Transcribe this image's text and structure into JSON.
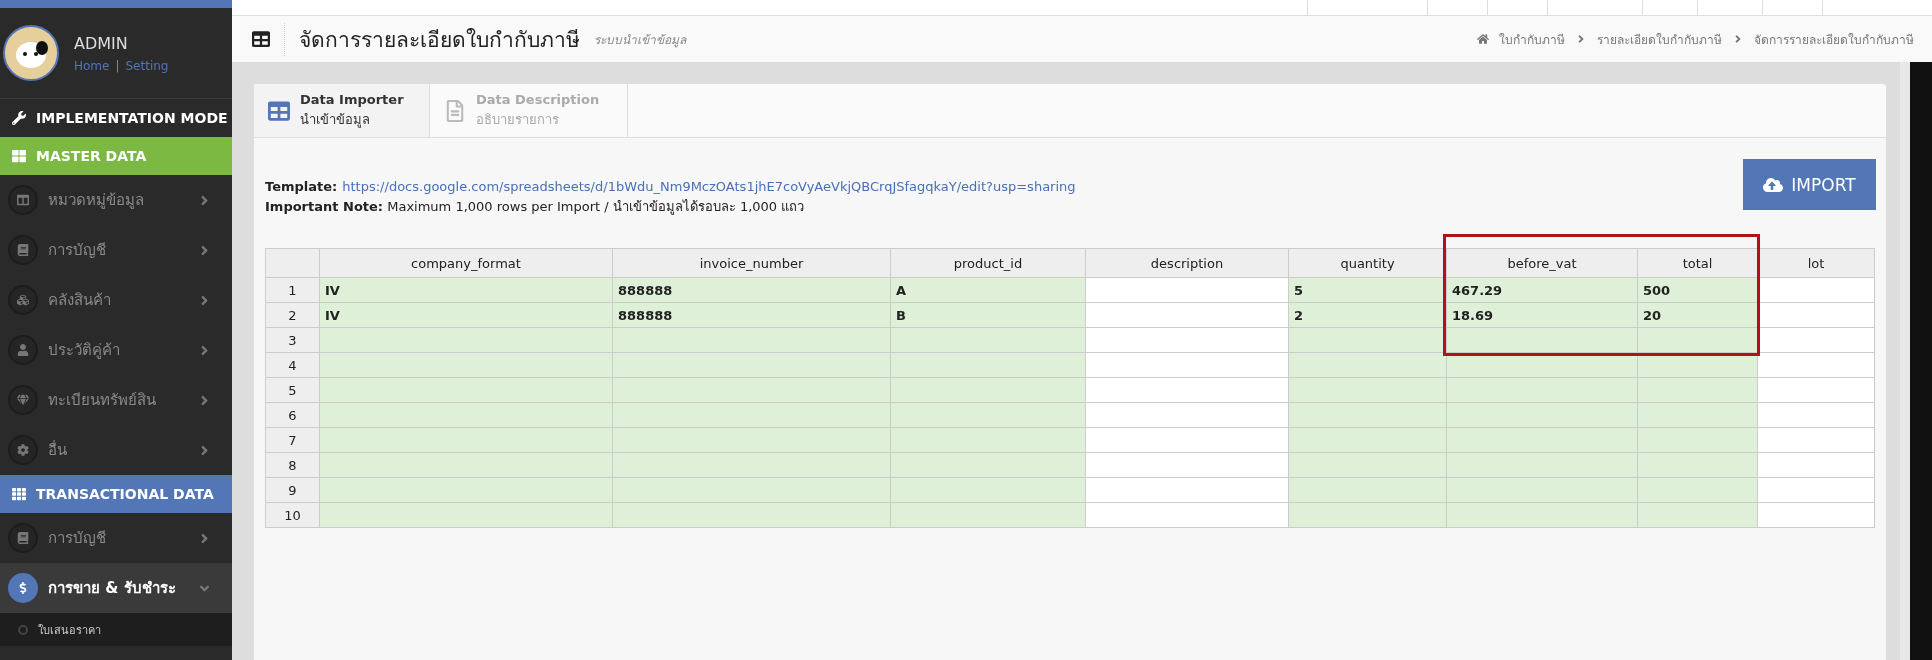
{
  "profile": {
    "name": "ADMIN",
    "links": [
      {
        "label": "Home"
      },
      {
        "label": "Setting"
      }
    ],
    "separator": "|"
  },
  "sidebar": [
    {
      "kind": "mode",
      "label": "IMPLEMENTATION MODE"
    },
    {
      "kind": "section",
      "label": "MASTER DATA",
      "color": "#7cb943"
    },
    {
      "kind": "item",
      "label": "หมวดหมู่ข้อมูล",
      "selected": false,
      "expanded": false
    },
    {
      "kind": "item",
      "label": "การบัญชี",
      "selected": false,
      "expanded": false
    },
    {
      "kind": "item",
      "label": "คลังสินค้า",
      "selected": false,
      "expanded": false
    },
    {
      "kind": "item",
      "label": "ประวัติคู่ค้า",
      "selected": false,
      "expanded": false
    },
    {
      "kind": "item",
      "label": "ทะเบียนทรัพย์สิน",
      "selected": false,
      "expanded": false
    },
    {
      "kind": "item",
      "label": "อื่น",
      "selected": false,
      "expanded": false
    },
    {
      "kind": "section",
      "label": "TRANSACTIONAL DATA",
      "color": "#5376b6"
    },
    {
      "kind": "item",
      "label": "การบัญชี",
      "selected": false,
      "expanded": false
    },
    {
      "kind": "item",
      "label": "การขาย & รับชำระ",
      "selected": true,
      "expanded": true,
      "children": [
        {
          "label": "ใบเสนอราคา"
        }
      ]
    }
  ],
  "header": {
    "title": "จัดการรายละเอียดใบกำกับภาษี",
    "subtitle": "ระบบนำเข้าข้อมูล",
    "breadcrumb": [
      "ใบกำกับภาษี",
      "รายละเอียดใบกำกับภาษี",
      "จัดการรายละเอียดใบกำกับภาษี"
    ]
  },
  "tabs": [
    {
      "title": "Data Importer",
      "subtitle": "นำเข้าข้อมูล",
      "selected": true
    },
    {
      "title": "Data Description",
      "subtitle": "อธิบายรายการ",
      "selected": false
    }
  ],
  "template": {
    "label": "Template:",
    "url": "https://docs.google.com/spreadsheets/d/1bWdu_Nm9MczOAts1jhE7coVyAeVkjQBCrqJSfagqkaY/edit?usp=sharing"
  },
  "note": "**Important Note:** Maximum 1,000 rows per Import / นำเข้าข้อมูลได้รอบละ 1,000 แถว",
  "import_button": "IMPORT",
  "table": {
    "annotation_frame": true,
    "columns": [
      {
        "name": "company_format",
        "required": true
      },
      {
        "name": "invoice_number",
        "required": true
      },
      {
        "name": "product_id",
        "required": true
      },
      {
        "name": "description",
        "required": false
      },
      {
        "name": "quantity",
        "required": true
      },
      {
        "name": "before_vat",
        "required": true
      },
      {
        "name": "total",
        "required": true
      },
      {
        "name": "lot",
        "required": false
      }
    ],
    "rows": [
      {
        "number": "1",
        "cells": [
          "IV",
          "888888",
          "A",
          null,
          "5",
          "467.29",
          "500",
          null
        ]
      },
      {
        "number": "2",
        "cells": [
          "IV",
          "888888",
          "B",
          null,
          "2",
          "18.69",
          "20",
          null
        ]
      },
      {
        "number": "3"
      },
      {
        "number": "4"
      },
      {
        "number": "5"
      },
      {
        "number": "6"
      },
      {
        "number": "7"
      },
      {
        "number": "8"
      },
      {
        "number": "9"
      },
      {
        "number": "10"
      }
    ]
  }
}
